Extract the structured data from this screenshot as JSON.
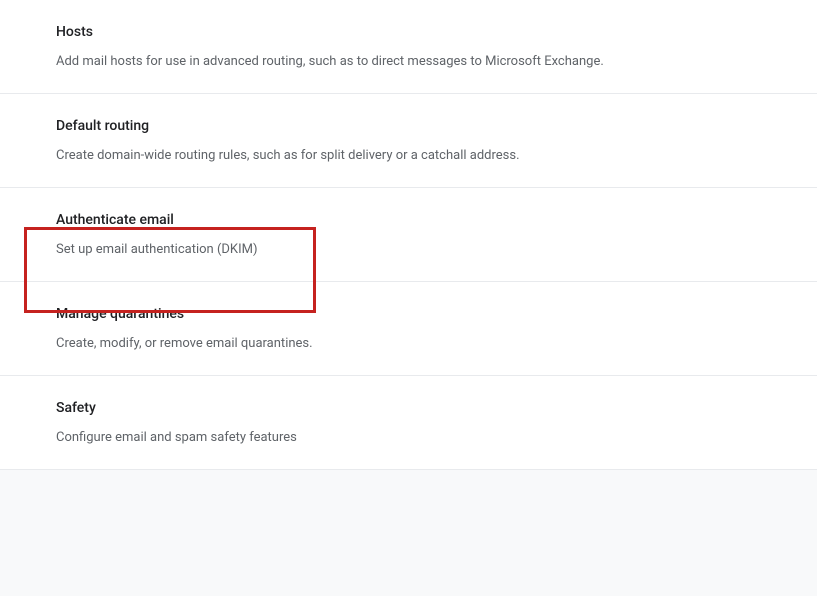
{
  "settings": [
    {
      "title": "Hosts",
      "description": "Add mail hosts for use in advanced routing, such as to direct messages to Microsoft Exchange."
    },
    {
      "title": "Default routing",
      "description": "Create domain-wide routing rules, such as for split delivery or a catchall address."
    },
    {
      "title": "Authenticate email",
      "description": "Set up email authentication (DKIM)"
    },
    {
      "title": "Manage quarantines",
      "description": "Create, modify, or remove email quarantines."
    },
    {
      "title": "Safety",
      "description": "Configure email and spam safety features"
    }
  ]
}
